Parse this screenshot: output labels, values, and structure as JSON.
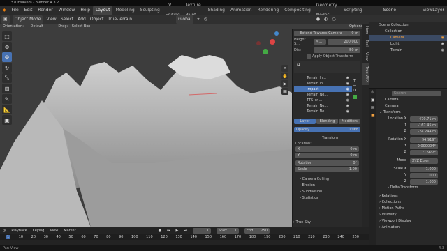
{
  "window_title": "* (Unsaved) - Blender 4.3.2",
  "menu": [
    "File",
    "Edit",
    "Render",
    "Window",
    "Help"
  ],
  "workspaces": [
    "Layout",
    "Modeling",
    "Sculpting",
    "UV Editing",
    "Texture Paint",
    "Shading",
    "Animation",
    "Rendering",
    "Compositing",
    "Geometry Nodes",
    "Scripting"
  ],
  "scene_name": "Scene",
  "view_layer": "ViewLayer",
  "header": {
    "mode": "Object Mode",
    "view": "View",
    "select": "Select",
    "add": "Add",
    "object": "Object",
    "true_terrain": "True-Terrain",
    "orientation_label": "Orientation:",
    "orientation": "Default",
    "drag_label": "Drag:",
    "drag": "Select Box",
    "global": "Global",
    "options": "Options"
  },
  "npanel": {
    "extend_button": "Extend Towards Camera",
    "extend_value": "0 m",
    "height_label": "Height S...",
    "height_mode": "M...",
    "height_value": "200.000",
    "dist_label": "Dist",
    "dist_value": "50 m",
    "apply_label": "Apply Object Transform",
    "layers": [
      "Terrain In...",
      "Terrain In...",
      "Impact",
      "Terrain No...",
      "TTS_sn...",
      "Terrain No...",
      "Terrain No..."
    ],
    "tabs": [
      "Layer",
      "Blending",
      "Modifiers"
    ],
    "opacity_label": "Opacity",
    "opacity_value": "0.968",
    "transform_label": "Transform",
    "location_label": "Location:",
    "x_label": "X",
    "x_value": "0 m",
    "y_label": "Y",
    "y_value": "0 m",
    "rotation_label": "Rotation",
    "rotation_value": "0°",
    "scale_label": "Scale",
    "scale_value": "1.00",
    "sections": [
      "Camera Culling",
      "Erosion",
      "Subdivision",
      "Statistics"
    ]
  },
  "ntabs": [
    "Item",
    "Tool",
    "View",
    "True-WFX"
  ],
  "outliner": {
    "scene_collection": "Scene Collection",
    "collection": "Collection",
    "items": [
      "Camera",
      "Light",
      "Terrain"
    ]
  },
  "properties": {
    "object_name": "Camera",
    "data_name": "Camera",
    "transform": "Transform",
    "location_label": "Location X",
    "loc": [
      "470.71 m",
      "-167.45 m",
      "-24.244 m"
    ],
    "rotation_label": "Rotation X",
    "rot": [
      "94.919°",
      "0.000004°",
      "71.972°"
    ],
    "mode_label": "Mode",
    "mode_value": "XYZ Euler",
    "scale_label": "Scale X",
    "scale": [
      "1.000",
      "1.000",
      "1.000"
    ],
    "axes": [
      "Y",
      "Z"
    ],
    "sections": [
      "Delta Transform",
      "Relations",
      "Collections",
      "Motion Paths",
      "Visibility",
      "Viewport Display",
      "Animation"
    ],
    "search_placeholder": "Search"
  },
  "timeline": {
    "playback": "Playback",
    "keying": "Keying",
    "view": "View",
    "marker": "Marker",
    "start_label": "Start",
    "start": "1",
    "end_label": "End",
    "end": "250",
    "current": "1",
    "ticks": [
      "1",
      "10",
      "20",
      "30",
      "40",
      "50",
      "60",
      "70",
      "80",
      "90",
      "100",
      "110",
      "120",
      "130",
      "140",
      "150",
      "160",
      "170",
      "180",
      "190",
      "200",
      "210",
      "220",
      "230",
      "240",
      "250"
    ]
  },
  "viewport_overlay_label": "True-Sky",
  "status": "Pan View",
  "version": "4.3"
}
